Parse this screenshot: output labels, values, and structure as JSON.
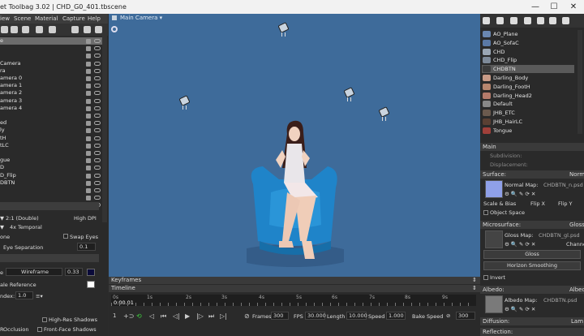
{
  "window": {
    "title": "et Toolbag 3.02  |  CHD_G0_401.tbscene",
    "min": "—",
    "max": "☐",
    "close": "✕"
  },
  "menu": [
    "iew",
    "Scene",
    "Material",
    "Capture",
    "Help"
  ],
  "outliner": {
    "items": [
      "e",
      "",
      "",
      "Camera",
      "ra",
      "amera 0",
      "amera 1",
      "amera 2",
      "amera 3",
      "amera 4",
      "",
      "ed",
      "ly",
      "tH",
      "tLC",
      "",
      "gue",
      "D",
      "D_Flip",
      "DBTN",
      "",
      "",
      ""
    ],
    "selected_index": 0
  },
  "render": {
    "aa_value": "2:1 (Double)",
    "high_dpi": "High DPI",
    "temporal": "4x Temporal",
    "none": "one",
    "swap_eyes": "Swap Eyes",
    "eye_sep_label": "Eye Separation",
    "eye_sep_value": "0.1",
    "wire_label": "Wireframe",
    "wire_value": "0.33",
    "scale_ref": "ale Reference",
    "index_label": "ndex:",
    "index_value": "1.0",
    "hires_shadows": "High-Res Shadows",
    "occlusion": "Occlusion",
    "frontface": "Front-Face Shadows",
    "occlusion_prefix": "R"
  },
  "viewport": {
    "camera_label": "Main Camera ▾",
    "bg_color": "#3e6b9a"
  },
  "timeline": {
    "keyframes_label": "Keyframes",
    "timeline_label": "Timeline",
    "ticks": [
      "0s",
      "1s",
      "2s",
      "3s",
      "4s",
      "5s",
      "6s",
      "7s",
      "8s",
      "9s"
    ],
    "current_time": "0:00.01",
    "frame": "1",
    "frames_label": "Frames",
    "frames_value": "300",
    "fps_label": "FPS",
    "fps_value": "30.000",
    "length_label": "Length",
    "length_value": "10.000",
    "speed_label": "Speed",
    "speed_value": "1.000",
    "bake_label": "Bake Speed",
    "bake_value": "300"
  },
  "materials": {
    "items": [
      {
        "name": "AO_Plane",
        "color": "#6a87b0"
      },
      {
        "name": "AO_SofaC",
        "color": "#5a79a6"
      },
      {
        "name": "CHD",
        "color": "#9aa6b4"
      },
      {
        "name": "CHD_Flip",
        "color": "#7e8a99"
      },
      {
        "name": "CHDBTN",
        "color": "#3b3b3b"
      },
      {
        "name": "Darling_Body",
        "color": "#c89a86"
      },
      {
        "name": "Darling_FootH",
        "color": "#b8866e"
      },
      {
        "name": "Darling_Head2",
        "color": "#b47a6a"
      },
      {
        "name": "Default",
        "color": "#888888"
      },
      {
        "name": "JHB_ETC",
        "color": "#6b5a4e"
      },
      {
        "name": "JHB_HairLC",
        "color": "#5a4033"
      },
      {
        "name": "Tongue",
        "color": "#a0403a"
      }
    ],
    "selected_index": 4
  },
  "properties": {
    "main": "Main",
    "subdivision": "Subdivision:",
    "displacement": "Displacement:",
    "surface": "Surface:",
    "surface_value": "Normal",
    "normal_map": "Normal Map:",
    "normal_file": "CHDBTN_n.psd",
    "scale_bias": "Scale & Bias",
    "flip_x": "Flip X",
    "flip_y": "Flip Y",
    "object_space": "Object Space",
    "microsurface": "Microsurface:",
    "microsurface_value": "Gloss",
    "gloss_map": "Gloss Map:",
    "gloss_file": "CHDBTN_gl.psd",
    "channel": "Channe",
    "gloss": "Gloss",
    "horizon": "Horizon Smoothing",
    "invert": "Invert",
    "albedo": "Albedo:",
    "albedo_value": "Albedo",
    "albedo_map": "Albedo Map:",
    "albedo_file": "CHDBTN.psd",
    "diffusion": "Diffusion:",
    "diffusion_value": "Lam",
    "reflection": "Reflection:"
  }
}
